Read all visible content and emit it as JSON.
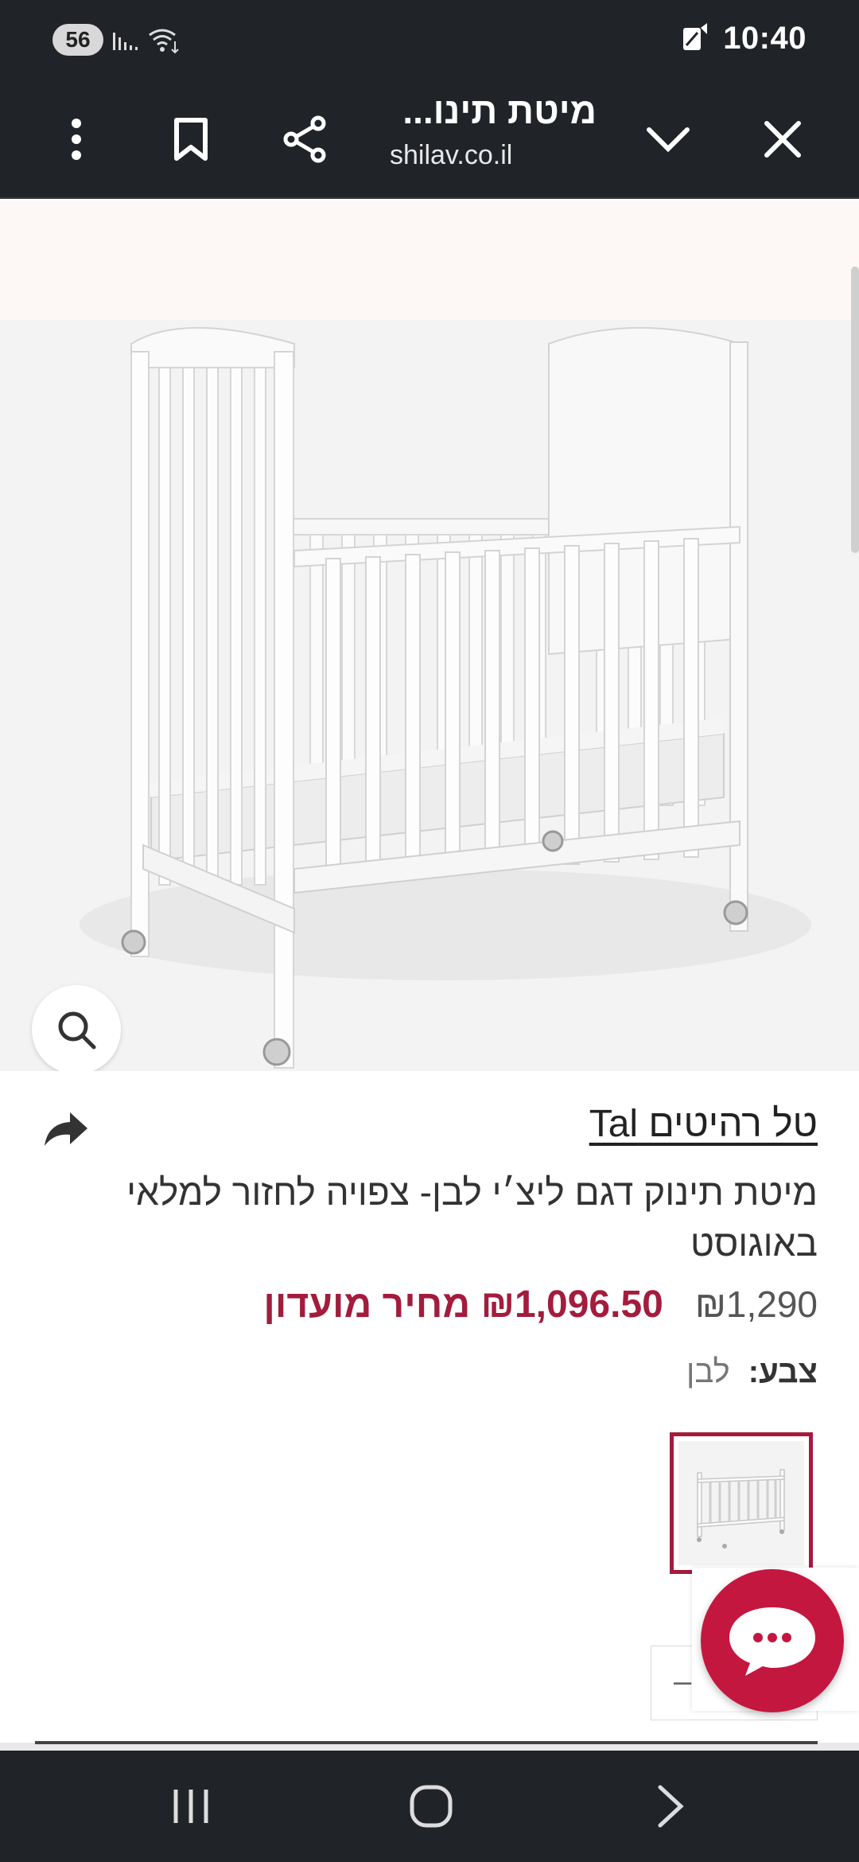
{
  "status": {
    "network_badge": "56",
    "time": "10:40"
  },
  "browser": {
    "title": "מיטת תינו...",
    "url": "shilav.co.il"
  },
  "product": {
    "brand": "טל רהיטים Tal",
    "name": "מיטת תינוק דגם ליצ׳י לבן- צפויה לחזור למלאי באוגוסט",
    "price_regular": "₪1,290",
    "price_club": "₪1,096.50 מחיר מועדון",
    "color_label": "צבע:",
    "color_value": "לבן"
  },
  "quantity": {
    "minus": "–"
  },
  "colors": {
    "accent": "#a31c3d",
    "chat": "#c4173f",
    "chrome": "#202328"
  },
  "icons": [
    "more-vert-icon",
    "bookmark-icon",
    "share-icon",
    "chevron-down-icon",
    "close-icon",
    "search-icon",
    "forward-arrow-icon",
    "chat-icon",
    "recent-apps-icon",
    "home-icon",
    "back-icon"
  ]
}
